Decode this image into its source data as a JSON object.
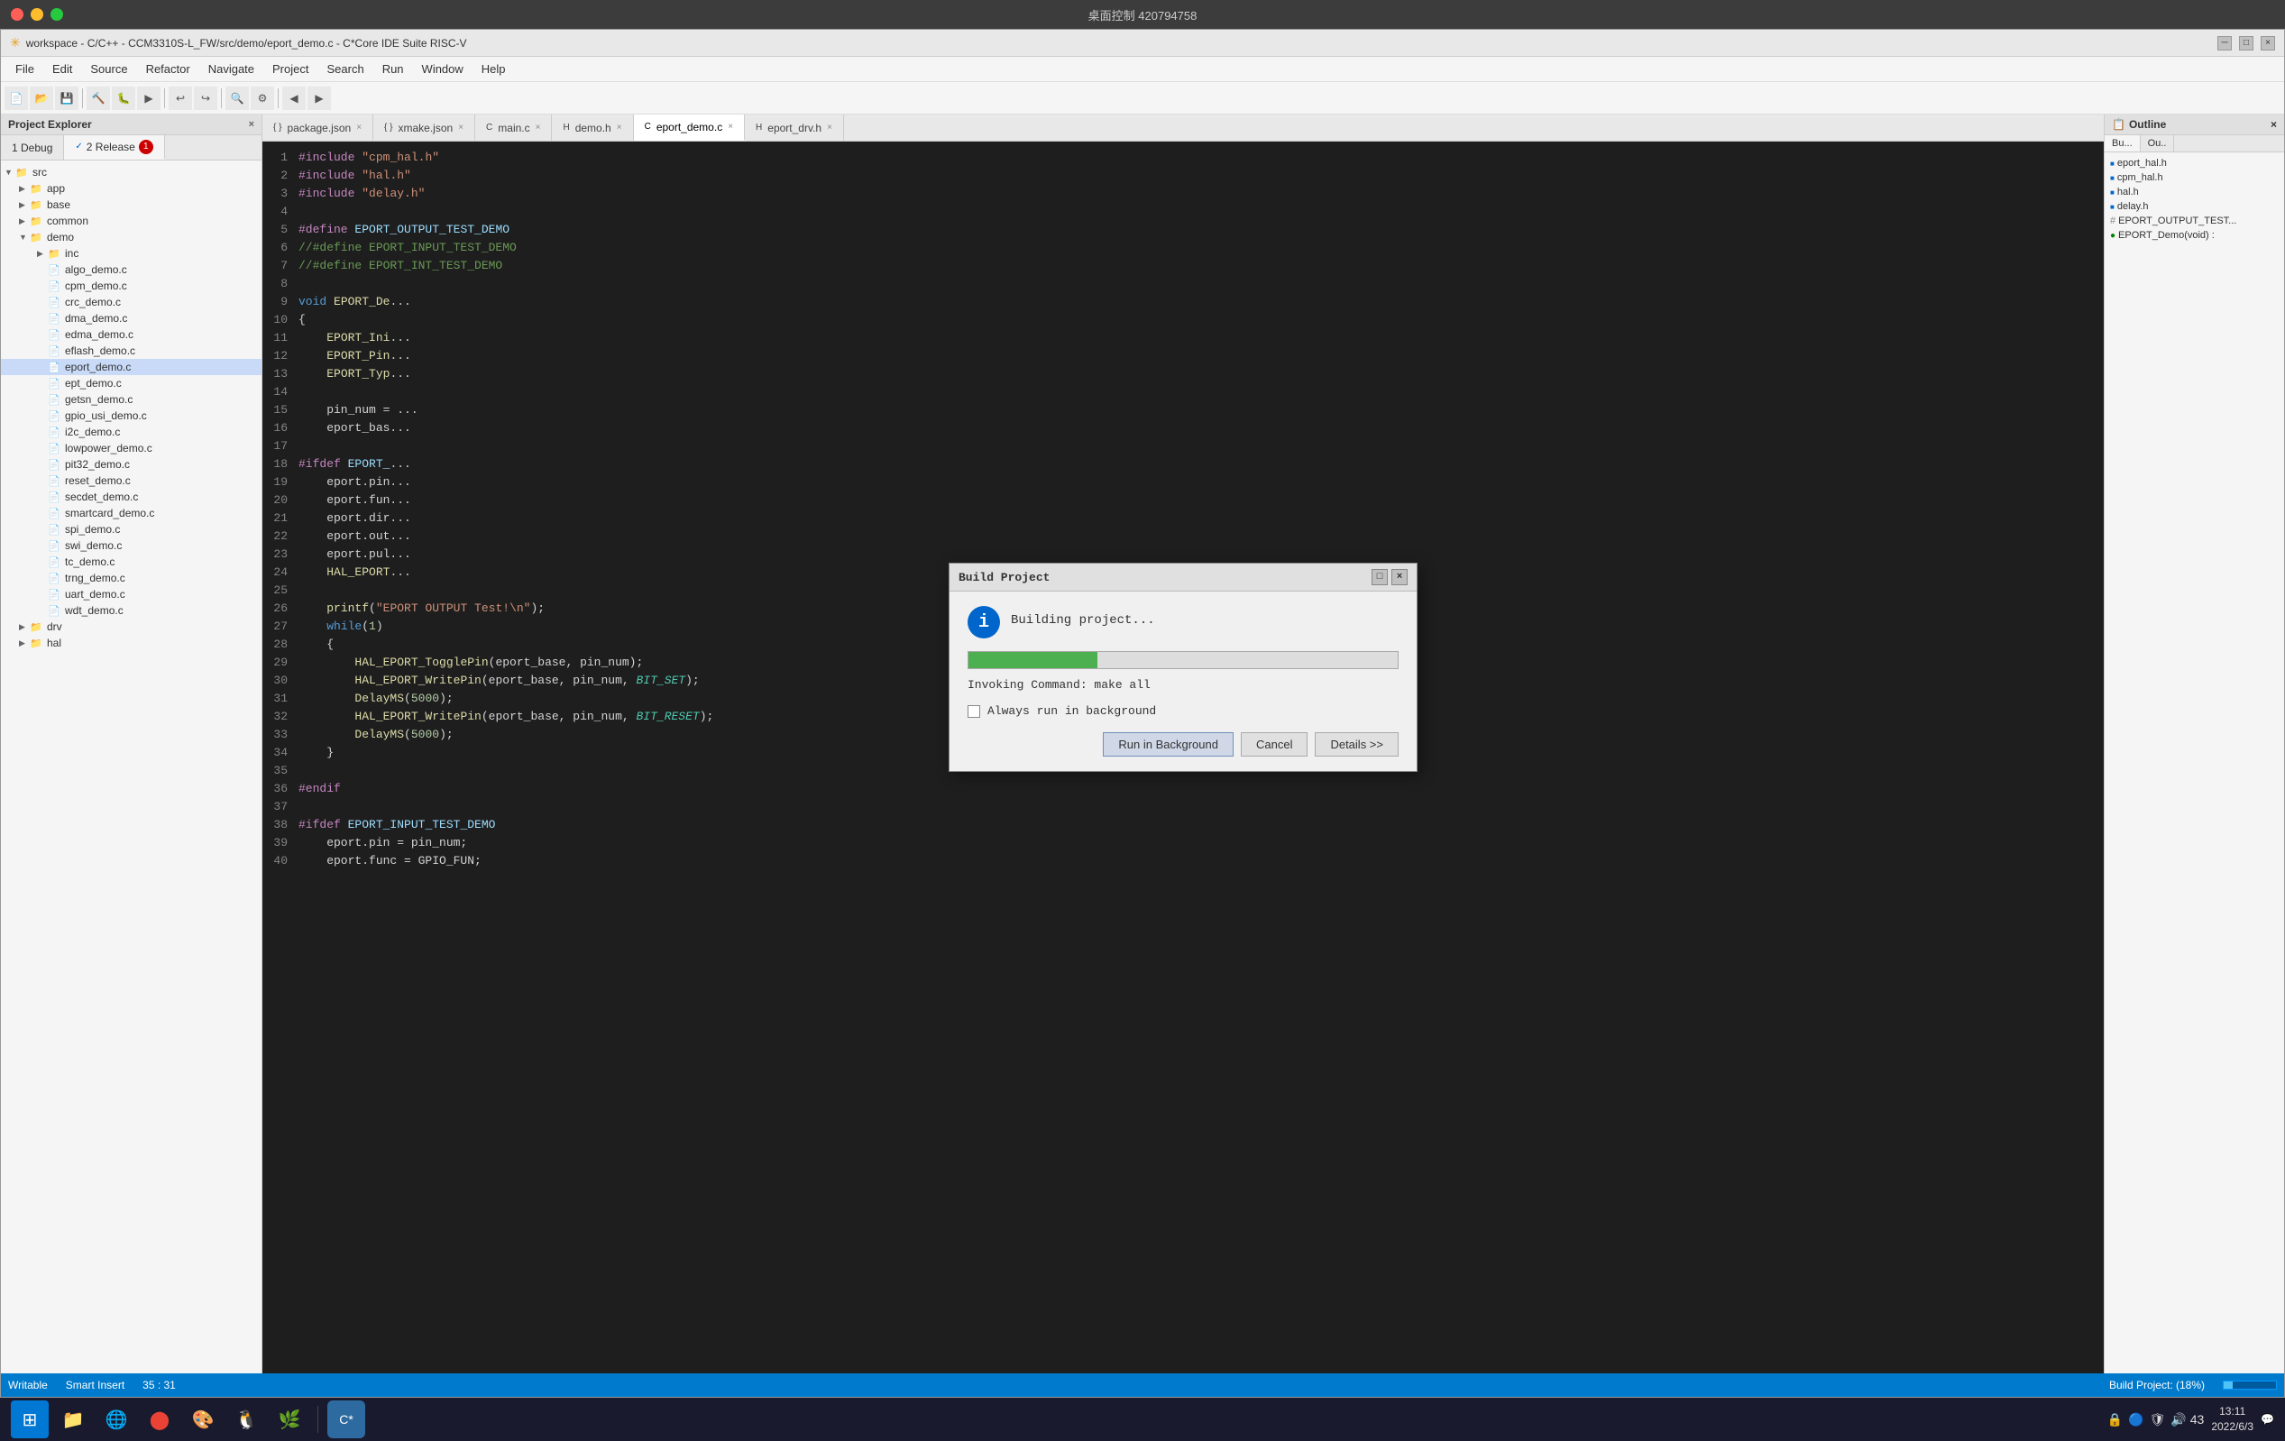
{
  "window": {
    "title": "桌面控制 420794758",
    "ide_title": "workspace - C/C++ - CCM3310S-L_FW/src/demo/eport_demo.c - C*Core IDE Suite RISC-V"
  },
  "menu": {
    "items": [
      "File",
      "Edit",
      "Source",
      "Refactor",
      "Navigate",
      "Project",
      "Search",
      "Run",
      "Window",
      "Help"
    ]
  },
  "project_explorer": {
    "label": "Project Explorer",
    "close_label": "×",
    "build_tabs": [
      {
        "label": "1 Debug",
        "active": false
      },
      {
        "label": "2 Release",
        "active": true,
        "badge": "1"
      }
    ],
    "tree": [
      {
        "level": 0,
        "type": "folder",
        "label": "src",
        "expanded": true
      },
      {
        "level": 1,
        "type": "folder",
        "label": "app",
        "expanded": false
      },
      {
        "level": 1,
        "type": "folder",
        "label": "base",
        "expanded": false
      },
      {
        "level": 1,
        "type": "folder",
        "label": "common",
        "expanded": false
      },
      {
        "level": 1,
        "type": "folder",
        "label": "demo",
        "expanded": true
      },
      {
        "level": 2,
        "type": "folder",
        "label": "inc",
        "expanded": false
      },
      {
        "level": 2,
        "type": "file",
        "label": "algo_demo.c"
      },
      {
        "level": 2,
        "type": "file",
        "label": "cpm_demo.c"
      },
      {
        "level": 2,
        "type": "file",
        "label": "crc_demo.c"
      },
      {
        "level": 2,
        "type": "file",
        "label": "dma_demo.c"
      },
      {
        "level": 2,
        "type": "file",
        "label": "edma_demo.c"
      },
      {
        "level": 2,
        "type": "file",
        "label": "eflash_demo.c"
      },
      {
        "level": 2,
        "type": "file",
        "label": "eport_demo.c",
        "selected": true
      },
      {
        "level": 2,
        "type": "file",
        "label": "ept_demo.c"
      },
      {
        "level": 2,
        "type": "file",
        "label": "getsn_demo.c"
      },
      {
        "level": 2,
        "type": "file",
        "label": "gpio_usi_demo.c"
      },
      {
        "level": 2,
        "type": "file",
        "label": "i2c_demo.c"
      },
      {
        "level": 2,
        "type": "file",
        "label": "lowpower_demo.c"
      },
      {
        "level": 2,
        "type": "file",
        "label": "pit32_demo.c"
      },
      {
        "level": 2,
        "type": "file",
        "label": "reset_demo.c"
      },
      {
        "level": 2,
        "type": "file",
        "label": "secdet_demo.c"
      },
      {
        "level": 2,
        "type": "file",
        "label": "smartcard_demo.c"
      },
      {
        "level": 2,
        "type": "file",
        "label": "spi_demo.c"
      },
      {
        "level": 2,
        "type": "file",
        "label": "swi_demo.c"
      },
      {
        "level": 2,
        "type": "file",
        "label": "tc_demo.c"
      },
      {
        "level": 2,
        "type": "file",
        "label": "trng_demo.c"
      },
      {
        "level": 2,
        "type": "file",
        "label": "uart_demo.c"
      },
      {
        "level": 2,
        "type": "file",
        "label": "wdt_demo.c"
      },
      {
        "level": 1,
        "type": "folder",
        "label": "drv",
        "expanded": false
      },
      {
        "level": 1,
        "type": "folder",
        "label": "hal",
        "expanded": false
      }
    ]
  },
  "editor": {
    "tabs": [
      {
        "label": "package.json",
        "active": false
      },
      {
        "label": "xmake.json",
        "active": false
      },
      {
        "label": "main.c",
        "active": false
      },
      {
        "label": "demo.h",
        "active": false
      },
      {
        "label": "eport_demo.c",
        "active": true,
        "modified": true
      },
      {
        "label": "eport_drv.h",
        "active": false
      }
    ],
    "code_lines": [
      "#include \"cpm_hal.h\"",
      "#include \"hal.h\"",
      "#include \"delay.h\"",
      "",
      "#define EPORT_OUTPUT_TEST_DEMO",
      "//#define EPORT_INPUT_TEST_DEMO",
      "//#define EPORT_INT_TEST_DEMO",
      "",
      "void EPORT_De...",
      "{",
      "    EPORT_Ini...",
      "    EPORT_Pin...",
      "    EPORT_Typ...",
      "",
      "    pin_num = ...",
      "    eport_bas...",
      "",
      "#ifdef EPORT_...",
      "    eport.pin...",
      "    eport.fun...",
      "    eport.dir...",
      "    eport.out...",
      "    eport.pul...",
      "    HAL_EPORT...",
      "",
      "    printf(\"EPORT OUTPUT Test!\\n\");",
      "    while(1)",
      "    {",
      "        HAL_EPORT_TogglePin(eport_base, pin_num);",
      "        HAL_EPORT_WritePin(eport_base, pin_num, BIT_SET);",
      "        DelayMS(5000);",
      "        HAL_EPORT_WritePin(eport_base, pin_num, BIT_RESET);",
      "        DelayMS(5000);",
      "    }",
      "",
      "#endif",
      "",
      "#ifdef EPORT_INPUT_TEST_DEMO",
      "    eport.pin = pin_num;",
      "    eport.func = GPIO_FUN;"
    ]
  },
  "right_panel": {
    "tabs": [
      "Bu...",
      "Ou.."
    ],
    "items": [
      {
        "type": "file",
        "label": "eport_hal.h"
      },
      {
        "type": "file",
        "label": "cpm_hal.h"
      },
      {
        "type": "file",
        "label": "hal.h"
      },
      {
        "type": "file",
        "label": "delay.h"
      },
      {
        "type": "macro",
        "label": "EPORT_OUTPUT_TEST..."
      },
      {
        "type": "func",
        "label": "EPORT_Demo(void) :"
      }
    ]
  },
  "dialog": {
    "title": "Build Project",
    "status_text": "Building project...",
    "progress_percent": 30,
    "cmd_text": "Invoking Command: make all",
    "checkbox_label": "Always run in background",
    "checkbox_checked": false,
    "buttons": {
      "run_bg": "Run in Background",
      "cancel": "Cancel",
      "details": "Details >>"
    }
  },
  "status_bar": {
    "writable": "Writable",
    "smart_insert": "Smart Insert",
    "position": "35 : 31",
    "build_status": "Build Project: (18%)"
  },
  "taskbar": {
    "time": "13:11",
    "date": "2022/6/3",
    "systray": "🔊 43"
  }
}
